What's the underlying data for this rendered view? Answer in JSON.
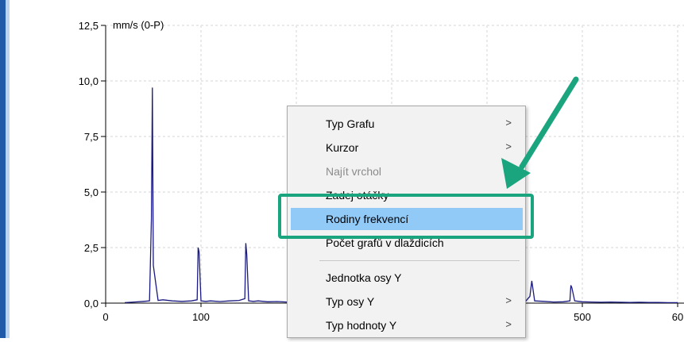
{
  "colors": {
    "accent_green": "#1aa57f",
    "series_color": "#1a1a80",
    "menu_highlight": "#91c9f7",
    "grid_color": "#d6d6d6"
  },
  "chart_data": {
    "type": "line",
    "title": "",
    "ylabel": "mm/s (0-P)",
    "xlabel": "",
    "xlim": [
      0,
      600
    ],
    "ylim": [
      0,
      12.5
    ],
    "y_tick_labels": [
      "12,5",
      "10,0",
      "7,5",
      "5,0",
      "2,5",
      "0,0"
    ],
    "x_tick_labels": [
      "0",
      "100",
      "500",
      "60"
    ],
    "grid": true,
    "series": [
      {
        "x": [
          20,
          30,
          40,
          46,
          48,
          49,
          50,
          55,
          60,
          70,
          80,
          90,
          96,
          97,
          98,
          100,
          105,
          110,
          120,
          130,
          140,
          146,
          147,
          148,
          150,
          155,
          160,
          170,
          180,
          190,
          440,
          445,
          447,
          450,
          460,
          470,
          480,
          487,
          488,
          489,
          492,
          500,
          510,
          520,
          530,
          540,
          550,
          560,
          570,
          580,
          590,
          600
        ],
        "y": [
          0.02,
          0.05,
          0.08,
          0.1,
          3.8,
          9.7,
          1.7,
          0.12,
          0.15,
          0.1,
          0.08,
          0.1,
          0.15,
          2.5,
          2.3,
          0.1,
          0.08,
          0.1,
          0.07,
          0.1,
          0.12,
          0.2,
          2.7,
          2.2,
          0.1,
          0.08,
          0.1,
          0.06,
          0.07,
          0.05,
          0.06,
          0.3,
          1.0,
          0.1,
          0.08,
          0.05,
          0.06,
          0.1,
          0.8,
          0.7,
          0.1,
          0.06,
          0.05,
          0.04,
          0.05,
          0.04,
          0.03,
          0.04,
          0.03,
          0.03,
          0.02,
          0.02
        ]
      }
    ]
  },
  "context_menu": {
    "items": [
      {
        "label": "Typ Grafu",
        "submenu": true,
        "disabled": false,
        "highlighted": false
      },
      {
        "label": "Kurzor",
        "submenu": true,
        "disabled": false,
        "highlighted": false
      },
      {
        "label": "Najít vrchol",
        "submenu": false,
        "disabled": true,
        "highlighted": false
      },
      {
        "label": "Zadej otáčky",
        "submenu": false,
        "disabled": false,
        "highlighted": false
      },
      {
        "label": "Rodiny frekvencí",
        "submenu": false,
        "disabled": false,
        "highlighted": true
      },
      {
        "label": "Počet grafů v dlaždicích",
        "submenu": false,
        "disabled": false,
        "highlighted": false
      },
      {
        "label": "Jednotka osy Y",
        "submenu": false,
        "disabled": false,
        "highlighted": false
      },
      {
        "label": "Typ osy Y",
        "submenu": true,
        "disabled": false,
        "highlighted": false
      },
      {
        "label": "Typ hodnoty Y",
        "submenu": true,
        "disabled": false,
        "highlighted": false
      }
    ],
    "submenu_arrow": ">"
  }
}
